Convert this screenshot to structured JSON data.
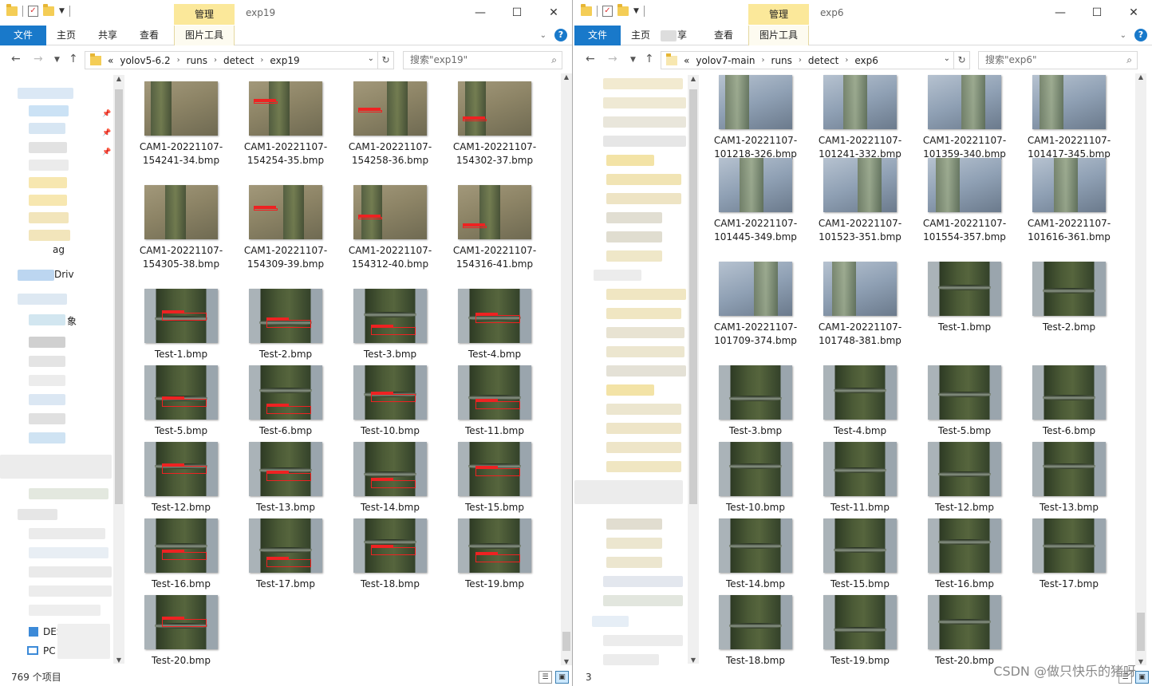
{
  "left": {
    "manage_tab": "管理",
    "title": "exp19",
    "ribbon": {
      "file": "文件",
      "home": "主页",
      "share": "共享",
      "view": "查看",
      "picture_tools": "图片工具"
    },
    "breadcrumb": [
      "«",
      "yolov5-6.2",
      "runs",
      "detect",
      "exp19"
    ],
    "search_placeholder": "搜索\"exp19\"",
    "status": "769 个项目",
    "nav_visible_labels": [
      "ag",
      "Driv",
      "象",
      "DES",
      "PC"
    ],
    "files": [
      "CAM1-20221107-154241-34.bmp",
      "CAM1-20221107-154254-35.bmp",
      "CAM1-20221107-154258-36.bmp",
      "CAM1-20221107-154302-37.bmp",
      "CAM1-20221107-154305-38.bmp",
      "CAM1-20221107-154309-39.bmp",
      "CAM1-20221107-154312-40.bmp",
      "CAM1-20221107-154316-41.bmp",
      "Test-1.bmp",
      "Test-2.bmp",
      "Test-3.bmp",
      "Test-4.bmp",
      "Test-5.bmp",
      "Test-6.bmp",
      "Test-10.bmp",
      "Test-11.bmp",
      "Test-12.bmp",
      "Test-13.bmp",
      "Test-14.bmp",
      "Test-15.bmp",
      "Test-16.bmp",
      "Test-17.bmp",
      "Test-18.bmp",
      "Test-19.bmp",
      "Test-20.bmp"
    ]
  },
  "right": {
    "manage_tab": "管理",
    "title": "exp6",
    "ribbon": {
      "file": "文件",
      "home": "主页",
      "share": "享",
      "view": "查看",
      "picture_tools": "图片工具"
    },
    "breadcrumb": [
      "«",
      "yolov7-main",
      "runs",
      "detect",
      "exp6"
    ],
    "search_placeholder": "搜索\"exp6\"",
    "status": "3",
    "files": [
      "CAM1-20221107-101218-326.bmp",
      "CAM1-20221107-101241-332.bmp",
      "CAM1-20221107-101359-340.bmp",
      "CAM1-20221107-101417-345.bmp",
      "CAM1-20221107-101445-349.bmp",
      "CAM1-20221107-101523-351.bmp",
      "CAM1-20221107-101554-357.bmp",
      "CAM1-20221107-101616-361.bmp",
      "CAM1-20221107-101709-374.bmp",
      "CAM1-20221107-101748-381.bmp",
      "Test-1.bmp",
      "Test-2.bmp",
      "Test-3.bmp",
      "Test-4.bmp",
      "Test-5.bmp",
      "Test-6.bmp",
      "Test-10.bmp",
      "Test-11.bmp",
      "Test-12.bmp",
      "Test-13.bmp",
      "Test-14.bmp",
      "Test-15.bmp",
      "Test-16.bmp",
      "Test-17.bmp",
      "Test-18.bmp",
      "Test-19.bmp",
      "Test-20.bmp"
    ]
  },
  "window_controls": {
    "minimize": "—",
    "maximize": "☐",
    "close": "✕"
  },
  "watermark": "CSDN @做只快乐的猪呀",
  "colors": {
    "file_tab": "#1979ca",
    "manage_tab": "#fbe89a",
    "detection_box": "#e22"
  }
}
